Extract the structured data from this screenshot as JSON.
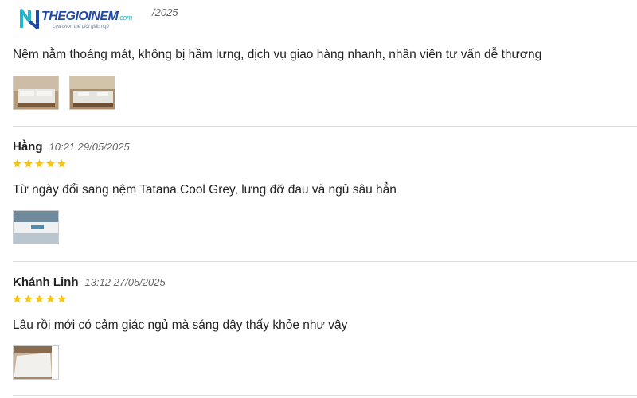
{
  "brand": {
    "name": "THEGIOINEM",
    "suffix": ".com",
    "tagline": "Lựa chọn thế giới giấc ngủ"
  },
  "top_review": {
    "date_fragment": "/2025",
    "text": "Nệm nằm thoáng mát, không bị hầm lưng, dịch vụ giao hàng nhanh, nhân viên tư vấn dễ thương",
    "image_count": 2
  },
  "reviews": [
    {
      "author": "Hằng",
      "time": "10:21 29/05/2025",
      "rating": 5,
      "text": "Từ ngày đổi sang nệm Tatana Cool Grey, lưng đỡ đau và ngủ sâu hẳn",
      "image_count": 1
    },
    {
      "author": "Khánh Linh",
      "time": "13:12 27/05/2025",
      "rating": 5,
      "text": "Lâu rồi mới có cảm giác ngủ mà sáng dậy thấy khỏe như vậy",
      "image_count": 1
    }
  ],
  "colors": {
    "star": "#f5c518",
    "brand_blue": "#1f4aa8",
    "brand_teal": "#2bb3c8",
    "divider": "#dcdcdc"
  }
}
